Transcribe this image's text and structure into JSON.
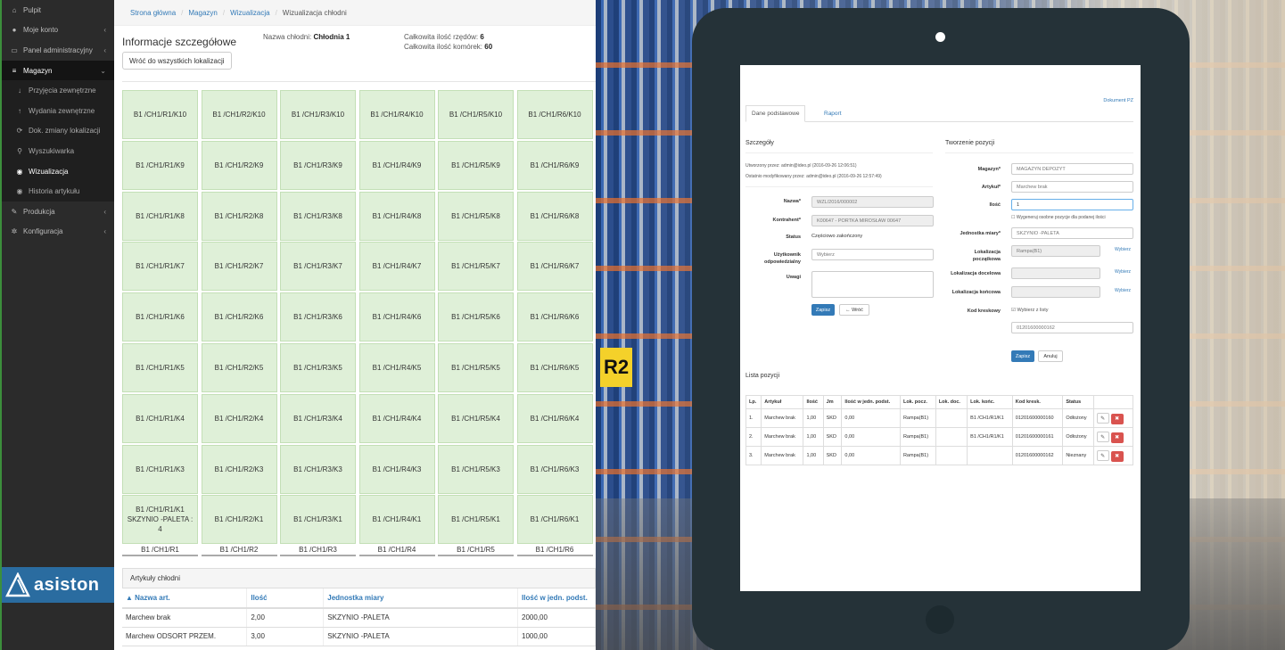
{
  "sidebar": {
    "items": [
      {
        "icon": "home-icon",
        "glyph": "⌂",
        "label": "Pulpit",
        "chev": ""
      },
      {
        "icon": "user-icon",
        "glyph": "●",
        "label": "Moje konto",
        "chev": "‹"
      },
      {
        "icon": "monitor-icon",
        "glyph": "▭",
        "label": "Panel administracyjny",
        "chev": "‹"
      },
      {
        "icon": "stack-icon",
        "glyph": "≡",
        "label": "Magazyn",
        "chev": "⌄"
      },
      {
        "icon": "arrow-down-icon",
        "glyph": "↓",
        "label": "Przyjęcia zewnętrzne",
        "chev": ""
      },
      {
        "icon": "arrow-up-icon",
        "glyph": "↑",
        "label": "Wydania zewnętrzne",
        "chev": ""
      },
      {
        "icon": "refresh-icon",
        "glyph": "⟳",
        "label": "Dok. zmiany lokalizacji",
        "chev": ""
      },
      {
        "icon": "search-icon",
        "glyph": "⚲",
        "label": "Wyszukiwarka",
        "chev": ""
      },
      {
        "icon": "eye-icon",
        "glyph": "◉",
        "label": "Wizualizacja",
        "chev": ""
      },
      {
        "icon": "eye-icon",
        "glyph": "◉",
        "label": "Historia artykułu",
        "chev": ""
      },
      {
        "icon": "wrench-icon",
        "glyph": "✎",
        "label": "Produkcja",
        "chev": "‹"
      },
      {
        "icon": "gear-icon",
        "glyph": "✲",
        "label": "Konfiguracja",
        "chev": "‹"
      }
    ],
    "logo": "asiston"
  },
  "breadcrumb": {
    "home": "Strona główna",
    "magazyn": "Magazyn",
    "wiz": "Wizualizacja",
    "current": "Wizualizacja chłodni"
  },
  "info": {
    "title": "Informacje szczegółowe",
    "back_button": "Wróć do wszystkich lokalizacji",
    "name_label": "Nazwa chłodni:",
    "name_value": "Chłodnia 1",
    "rows_label": "Całkowita ilość rzędów:",
    "rows_value": "6",
    "cells_label": "Całkowita ilość komórek:",
    "cells_value": "60"
  },
  "grid": {
    "columns": [
      {
        "footer": "B1 /CH1/R1",
        "cells": [
          "B1 /CH1/R1/K10",
          "B1 /CH1/R1/K9",
          "B1 /CH1/R1/K8",
          "B1 /CH1/R1/K7",
          "B1 /CH1/R1/K6",
          "B1 /CH1/R1/K5",
          "B1 /CH1/R1/K4",
          "B1 /CH1/R1/K3",
          "B1 /CH1/R1/K1 SKZYNIO -PALETA : 4"
        ]
      },
      {
        "footer": "B1 /CH1/R2",
        "cells": [
          "B1 /CH1/R2/K10",
          "B1 /CH1/R2/K9",
          "B1 /CH1/R2/K8",
          "B1 /CH1/R2/K7",
          "B1 /CH1/R2/K6",
          "B1 /CH1/R2/K5",
          "B1 /CH1/R2/K4",
          "B1 /CH1/R2/K3",
          "B1 /CH1/R2/K1"
        ]
      },
      {
        "footer": "B1 /CH1/R3",
        "cells": [
          "B1 /CH1/R3/K10",
          "B1 /CH1/R3/K9",
          "B1 /CH1/R3/K8",
          "B1 /CH1/R3/K7",
          "B1 /CH1/R3/K6",
          "B1 /CH1/R3/K5",
          "B1 /CH1/R3/K4",
          "B1 /CH1/R3/K3",
          "B1 /CH1/R3/K1"
        ]
      },
      {
        "footer": "B1 /CH1/R4",
        "cells": [
          "B1 /CH1/R4/K10",
          "B1 /CH1/R4/K9",
          "B1 /CH1/R4/K8",
          "B1 /CH1/R4/K7",
          "B1 /CH1/R4/K6",
          "B1 /CH1/R4/K5",
          "B1 /CH1/R4/K4",
          "B1 /CH1/R4/K3",
          "B1 /CH1/R4/K1"
        ]
      },
      {
        "footer": "B1 /CH1/R5",
        "cells": [
          "B1 /CH1/R5/K10",
          "B1 /CH1/R5/K9",
          "B1 /CH1/R5/K8",
          "B1 /CH1/R5/K7",
          "B1 /CH1/R5/K6",
          "B1 /CH1/R5/K5",
          "B1 /CH1/R5/K4",
          "B1 /CH1/R5/K3",
          "B1 /CH1/R5/K1"
        ]
      },
      {
        "footer": "B1 /CH1/R6",
        "cells": [
          "B1 /CH1/R6/K10",
          "B1 /CH1/R6/K9",
          "B1 /CH1/R6/K8",
          "B1 /CH1/R6/K7",
          "B1 /CH1/R6/K6",
          "B1 /CH1/R6/K5",
          "B1 /CH1/R6/K4",
          "B1 /CH1/R6/K3",
          "B1 /CH1/R6/K1"
        ]
      }
    ]
  },
  "articles": {
    "title": "Artykuły chłodni",
    "headers": [
      "▲ Nazwa art.",
      "Ilość",
      "Jednostka miary",
      "Ilość w jedn. podst."
    ],
    "rows": [
      [
        "Marchew brak",
        "2,00",
        "SKZYNIO -PALETA",
        "2000,00"
      ],
      [
        "Marchew ODSORT PRZEM.",
        "3,00",
        "SKZYNIO -PALETA",
        "1000,00"
      ]
    ]
  },
  "tablet": {
    "doc_link": "Dokument PZ",
    "tabs": [
      "Dane podstawowe",
      "Raport"
    ],
    "left": {
      "heading": "Szczegóły",
      "created": "Utworzony przez: admin@ideo.pl (2016-09-26 12:06:51)",
      "modified": "Ostatnio modyfikowany przez: admin@ideo.pl (2016-09-26 12:57:49)",
      "name_label": "Nazwa*",
      "name_value": "WZL/2016/000002",
      "contractor_label": "Kontrahent*",
      "contractor_value": "K00647 - PORTKA MIROSŁAW 00647",
      "status_label": "Status",
      "status_value": "Częściowo zakończony",
      "user_label": "Użytkownik odpowiedzialny",
      "user_value": "Wybierz",
      "notes_label": "Uwagi",
      "save": "Zapisz",
      "back": "← Wróć"
    },
    "right": {
      "heading": "Tworzenie pozycji",
      "store_label": "Magazyn*",
      "store_value": "MAGAZYN DEPOZYT",
      "article_label": "Artykuł*",
      "article_value": "Marchew brak",
      "qty_label": "Ilość",
      "qty_value": "1",
      "separate_check": "Wygeneruj osobne pozycje dla podanej ilości",
      "unit_label": "Jednostka miary*",
      "unit_value": "SKZYNIO -PALETA",
      "start_loc_label": "Lokalizacja początkowa",
      "start_loc_value": "Rampa(B1)",
      "target_loc_label": "Lokalizacja docelowa",
      "end_loc_label": "Lokalizacja końcowa",
      "choose": "Wybierz",
      "barcode_label": "Kod kreskowy",
      "barcode_check": "Wybierz z listy",
      "barcode_value": "01201600000162",
      "save": "Zapisz",
      "cancel": "Anuluj"
    },
    "list": {
      "heading": "Lista pozycji",
      "headers": [
        "Lp.",
        "Artykuł",
        "Ilość",
        "Jm",
        "Ilość w jedn. podst.",
        "Lok. pocz.",
        "Lok. doc.",
        "Lok. końc.",
        "Kod kresk.",
        "Status",
        ""
      ],
      "rows": [
        [
          "1.",
          "Marchew brak",
          "1,00",
          "SKD",
          "0,00",
          "Rampa(B1)",
          "",
          "B1 /CH1/R1/K1",
          "01201600000160",
          "Odłożony"
        ],
        [
          "2.",
          "Marchew brak",
          "1,00",
          "SKD",
          "0,00",
          "Rampa(B1)",
          "",
          "B1 /CH1/R1/K1",
          "01201600000161",
          "Odłożony"
        ],
        [
          "3.",
          "Marchew brak",
          "1,00",
          "SKD",
          "0,00",
          "Rampa(B1)",
          "",
          "",
          "01201600000162",
          "Nieznany"
        ]
      ]
    }
  },
  "background": {
    "rack_sign": "R2"
  }
}
